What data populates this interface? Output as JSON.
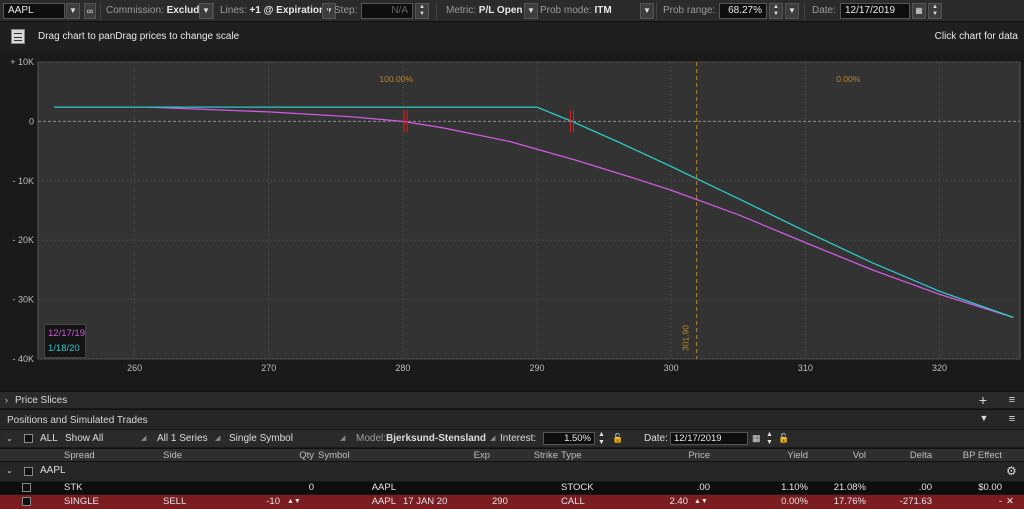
{
  "toolbar": {
    "symbol": "AAPL",
    "commission_label": "Commission:",
    "commission_value": "Exclude",
    "lines_label": "Lines:",
    "lines_value": "+1 @ Expiration",
    "step_label": "Step:",
    "step_value": "N/A",
    "metric_label": "Metric:",
    "metric_value": "P/L Open",
    "prob_mode_label": "Prob mode:",
    "prob_mode_value": "ITM",
    "prob_range_label": "Prob range:",
    "prob_range_value": "68.27%",
    "date_label": "Date:",
    "date_value": "12/17/2019"
  },
  "hint": {
    "drag_text": "Drag chart to panDrag prices to change scale",
    "click_text": "Click chart for data"
  },
  "chart_data": {
    "type": "line",
    "x_ticks": [
      "260",
      "270",
      "280",
      "290",
      "300",
      "310",
      "320"
    ],
    "y_ticks": [
      "+ 10K",
      "0",
      "- 10K",
      "- 20K",
      "- 30K",
      "- 40K"
    ],
    "xlim": [
      252.8,
      326
    ],
    "ylim": [
      -40000,
      10000
    ],
    "prob_left": "100.00%",
    "prob_right": "0.00%",
    "current_price_label": "301.90",
    "current_price": 301.9,
    "series": [
      {
        "name": "12/17/19",
        "color": "#d05ae0",
        "x": [
          261,
          270,
          276,
          280,
          283,
          288,
          293,
          297,
          300,
          305,
          310,
          315,
          320,
          325.5
        ],
        "y": [
          2400,
          1600,
          800,
          0,
          -1100,
          -3400,
          -6600,
          -9400,
          -11600,
          -15700,
          -20400,
          -25000,
          -29100,
          -33000
        ]
      },
      {
        "name": "1/18/20",
        "color": "#2ec8c8",
        "x": [
          254,
          260,
          270,
          280,
          290,
          292.6,
          296,
          300,
          305,
          310,
          315,
          320,
          325.5
        ],
        "y": [
          2400,
          2400,
          2400,
          2400,
          2400,
          0,
          -3400,
          -7600,
          -13000,
          -18500,
          -23800,
          -28600,
          -33000
        ]
      }
    ],
    "breakevens": [
      280.2,
      292.6
    ],
    "grid": true,
    "legend_position": "bottom-left"
  },
  "price_slices_label": "Price Slices",
  "positions_label": "Positions and Simulated Trades",
  "filters": {
    "all_label": "ALL",
    "show_all": "Show All",
    "series": "All 1 Series",
    "symbol_mode": "Single Symbol",
    "model_label": "Model:",
    "model_value": "Bjerksund-Stensland",
    "interest_label": "Interest:",
    "interest_value": "1.50%",
    "date_label": "Date:",
    "date_value": "12/17/2019"
  },
  "columns": [
    "Spread",
    "Side",
    "Qty",
    "Symbol",
    "Exp",
    "Strike",
    "Type",
    "Price",
    "Yield",
    "Vol",
    "Delta",
    "BP Effect"
  ],
  "group": "AAPL",
  "rows": [
    {
      "spread": "STK",
      "side": "",
      "qty": "0",
      "symbol": "AAPL",
      "exp": "",
      "strike": "",
      "type": "STOCK",
      "price": ".00",
      "yield": "1.10%",
      "vol": "21.08%",
      "delta": ".00",
      "bp": "$0.00"
    },
    {
      "spread": "SINGLE",
      "side": "SELL",
      "qty": "-10",
      "symbol": "AAPL",
      "exp": "17 JAN 20",
      "strike": "290",
      "type": "CALL",
      "price": "2.40",
      "yield": "0.00%",
      "vol": "17.76%",
      "delta": "-271.63",
      "bp": "-"
    }
  ]
}
